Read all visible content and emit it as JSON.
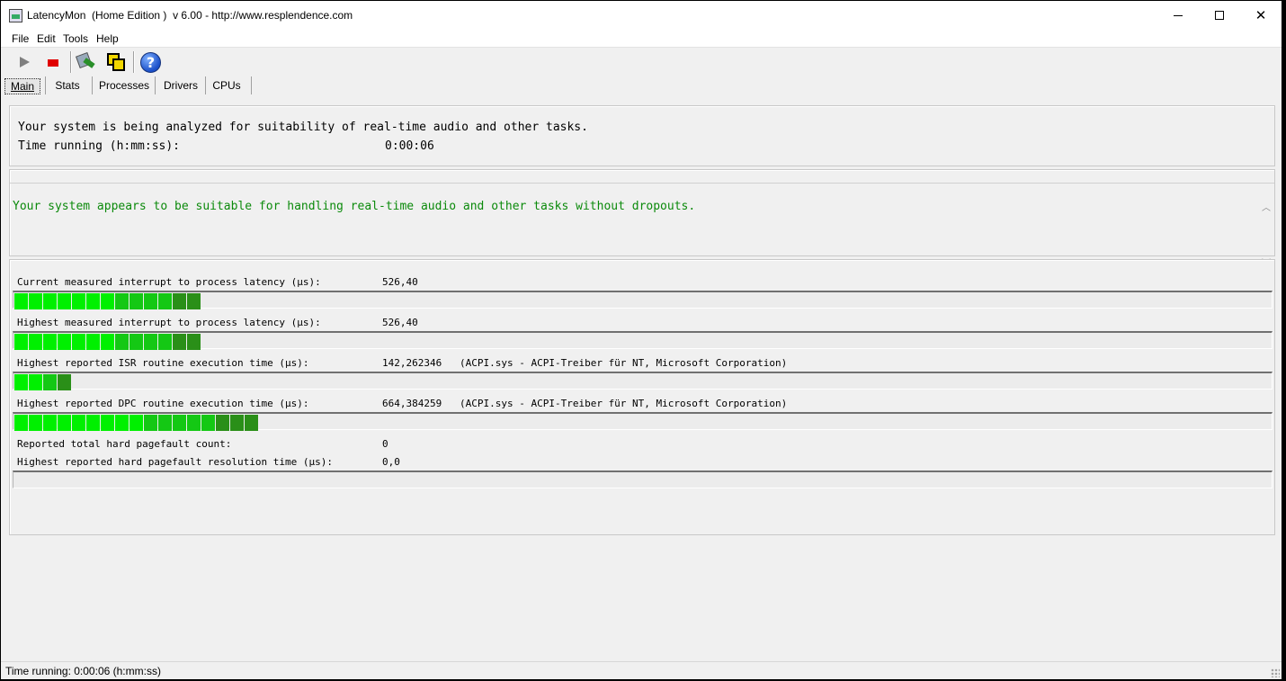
{
  "window": {
    "title": "LatencyMon  (Home Edition )  v 6.00 - http://www.resplendence.com"
  },
  "menu": [
    {
      "label": "File"
    },
    {
      "label": "Edit"
    },
    {
      "label": "Tools"
    },
    {
      "label": "Help"
    }
  ],
  "toolbar": {
    "icons": [
      "play-icon",
      "stop-icon",
      "process-monitor-icon",
      "cpu-windows-icon",
      "help-icon"
    ],
    "help_glyph": "?"
  },
  "tabs": [
    {
      "label": "Main",
      "selected": true
    },
    {
      "label": "Stats"
    },
    {
      "label": "Processes"
    },
    {
      "label": "Drivers"
    },
    {
      "label": "CPUs"
    }
  ],
  "summary": {
    "analyzing_text": "Your system is being analyzed for suitability of real-time audio and other tasks.",
    "time_label": "Time running (h:mm:ss):",
    "time_value": "0:00:06"
  },
  "verdict": {
    "text": "Your system appears to be suitable for handling real-time audio and other tasks without dropouts.",
    "color": "#0b8a0b"
  },
  "metrics": [
    {
      "label": "Current measured interrupt to process latency (µs):",
      "value": "526,40",
      "detail": "",
      "bar_segments": 13
    },
    {
      "label": "Highest measured interrupt to process latency (µs):",
      "value": "526,40",
      "detail": "",
      "bar_segments": 13
    },
    {
      "label": "Highest reported ISR routine execution time (µs):",
      "value": "142,262346",
      "detail": "(ACPI.sys - ACPI-Treiber für NT, Microsoft Corporation)",
      "bar_segments": 4
    },
    {
      "label": "Highest reported DPC routine execution time (µs):",
      "value": "664,384259",
      "detail": "(ACPI.sys - ACPI-Treiber für NT, Microsoft Corporation)",
      "bar_segments": 17
    },
    {
      "label": "Reported total hard pagefault count:",
      "value": "0",
      "detail": ""
    },
    {
      "label": "Highest reported hard pagefault resolution time (µs):",
      "value": "0,0",
      "detail": "",
      "bar_segments": 0
    }
  ],
  "colors": {
    "bar_bright": "#00f000",
    "bar_mid": "#14c814",
    "bar_dark": "#2a8f18"
  },
  "statusbar": {
    "text": "Time running: 0:00:06  (h:mm:ss)"
  }
}
